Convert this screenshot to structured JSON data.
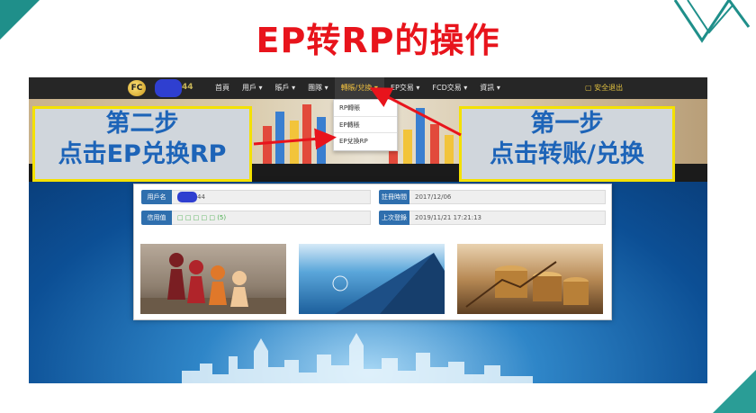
{
  "slide": {
    "title": "EP转RP的操作"
  },
  "navbar": {
    "logo_text": "FC",
    "user_suffix": "44",
    "items": [
      {
        "label": "首頁"
      },
      {
        "label": "用戶 ▾"
      },
      {
        "label": "賬戶 ▾"
      },
      {
        "label": "團隊 ▾"
      },
      {
        "label": "轉賬/兌換 ▾"
      },
      {
        "label": "EP交易 ▾"
      },
      {
        "label": "FCD交易 ▾"
      },
      {
        "label": "資訊 ▾"
      }
    ],
    "active_index": 4,
    "logout_label": "▢ 安全退出"
  },
  "dropdown": {
    "items": [
      {
        "label": "RP轉賬"
      },
      {
        "label": "EP轉賬"
      },
      {
        "label": "EP兌換RP"
      }
    ]
  },
  "account": {
    "username_label": "用戶名",
    "username_suffix": "44",
    "register_label": "註冊時間",
    "register_value": "2017/12/06",
    "credit_label": "信用值",
    "credit_value": "□ □ □ □ □ (5)",
    "last_login_label": "上次登錄",
    "last_login_value": "2019/11/21 17:21:13"
  },
  "callouts": {
    "step2_line1": "第二步",
    "step2_line2": "点击EP兑换RP",
    "step1_line1": "第一步",
    "step1_line2": "点击转账/兑换"
  },
  "colors": {
    "title_red": "#e8141c",
    "callout_text": "#1d64b8",
    "callout_border": "#f4e100",
    "arrow_red": "#e8141c",
    "nav_active": "#f0c040"
  }
}
